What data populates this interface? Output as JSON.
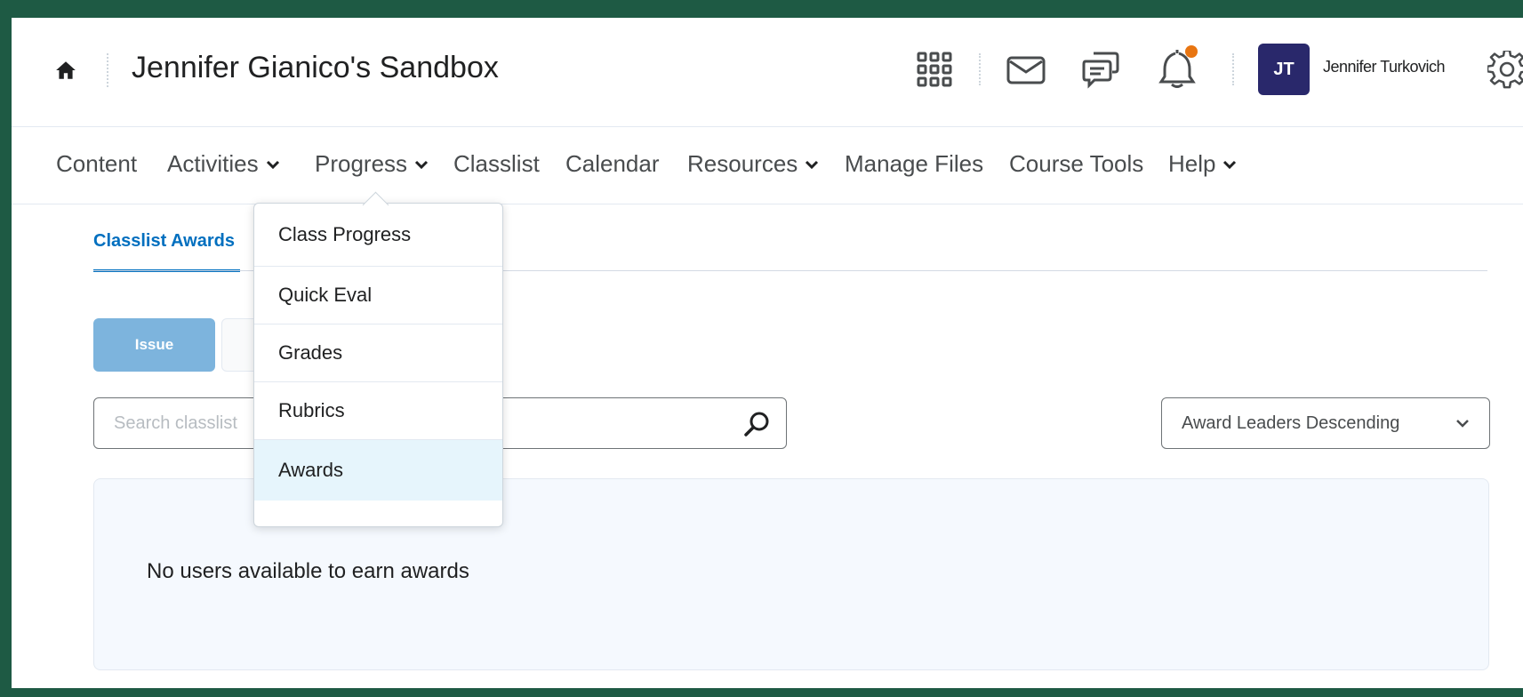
{
  "header": {
    "course_title": "Jennifer Gianico's Sandbox",
    "user_initials": "JT",
    "user_name": "Jennifer Turkovich",
    "icons": [
      "home-icon",
      "apps-grid-icon",
      "mail-icon",
      "chat-icon",
      "bell-icon",
      "gear-icon"
    ],
    "notification_dot_color": "#e87511",
    "avatar_color": "#29286b"
  },
  "nav": {
    "items": [
      {
        "label": "Content",
        "has_dropdown": false
      },
      {
        "label": "Activities",
        "has_dropdown": true
      },
      {
        "label": "Progress",
        "has_dropdown": true
      },
      {
        "label": "Classlist",
        "has_dropdown": false
      },
      {
        "label": "Calendar",
        "has_dropdown": false
      },
      {
        "label": "Resources",
        "has_dropdown": true
      },
      {
        "label": "Manage Files",
        "has_dropdown": false
      },
      {
        "label": "Course Tools",
        "has_dropdown": false
      },
      {
        "label": "Help",
        "has_dropdown": true
      }
    ]
  },
  "progress_menu": {
    "items": [
      {
        "label": "Class Progress"
      },
      {
        "label": "Quick Eval"
      },
      {
        "label": "Grades"
      },
      {
        "label": "Rubrics"
      },
      {
        "label": "Awards",
        "active": true
      }
    ]
  },
  "page": {
    "tab_label": "Classlist Awards",
    "issue_button": "Issue",
    "search_placeholder": "Search classlist",
    "sort_label": "Award Leaders Descending",
    "empty_message": "No users available to earn awards"
  },
  "colors": {
    "frame": "#1e5a44",
    "accent": "#006fbf",
    "issue_button": "#7db4dd",
    "menu_active": "#e6f5fc"
  }
}
